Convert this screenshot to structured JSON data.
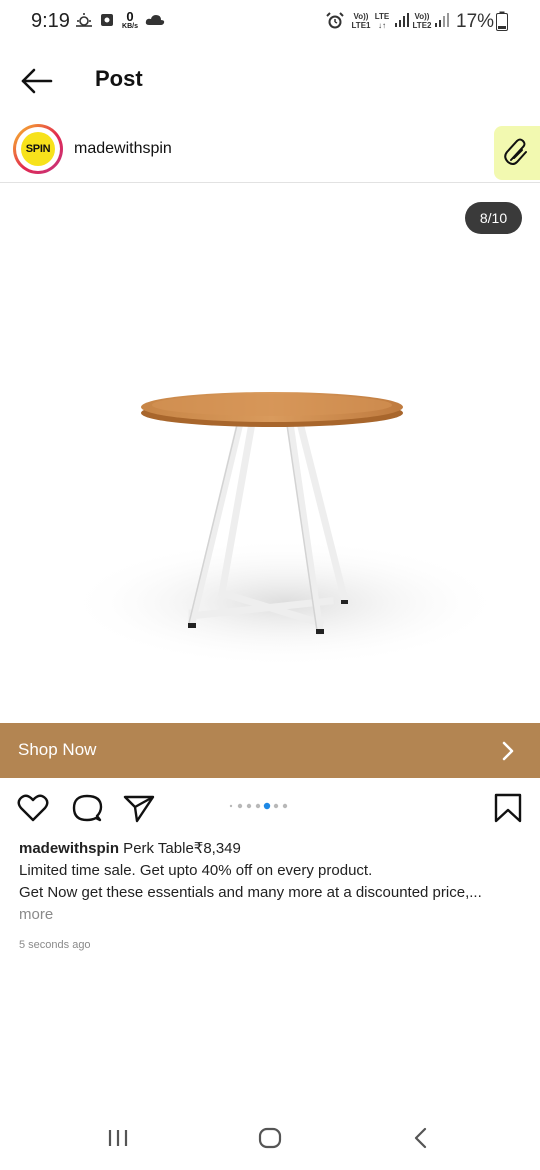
{
  "status_bar": {
    "time": "9:19",
    "data_rate_value": "0",
    "data_rate_unit": "KB/s",
    "sim1_top": "Vo))",
    "sim1_type": "LTE",
    "sim1_label": "LTE1",
    "sim2_top": "Vo))",
    "sim2_label": "LTE2",
    "battery": "17%"
  },
  "header": {
    "title": "Post"
  },
  "post": {
    "username": "madewithspin",
    "avatar_text": "SPIN",
    "image_counter": "8/10",
    "carousel_total": 7,
    "carousel_active": 5,
    "shop_label": "Shop Now",
    "caption_user": "madewithspin",
    "caption_title": " Perk Table₹8,349",
    "caption_line2": "Limited time sale. Get upto 40% off on every product.",
    "caption_line3": "Get Now get these essentials and many more at a  discounted price,...",
    "more_label": "more",
    "time_ago": "5 seconds ago"
  },
  "colors": {
    "shop_bar": "#b38552",
    "highlight": "#f2f9b0",
    "carousel_active": "#1e88e5"
  },
  "icons": [
    "back-arrow-icon",
    "paperclip-icon",
    "heart-icon",
    "comment-icon",
    "share-icon",
    "bookmark-icon",
    "chevron-right-icon",
    "recents-icon",
    "home-icon",
    "back-nav-icon"
  ]
}
